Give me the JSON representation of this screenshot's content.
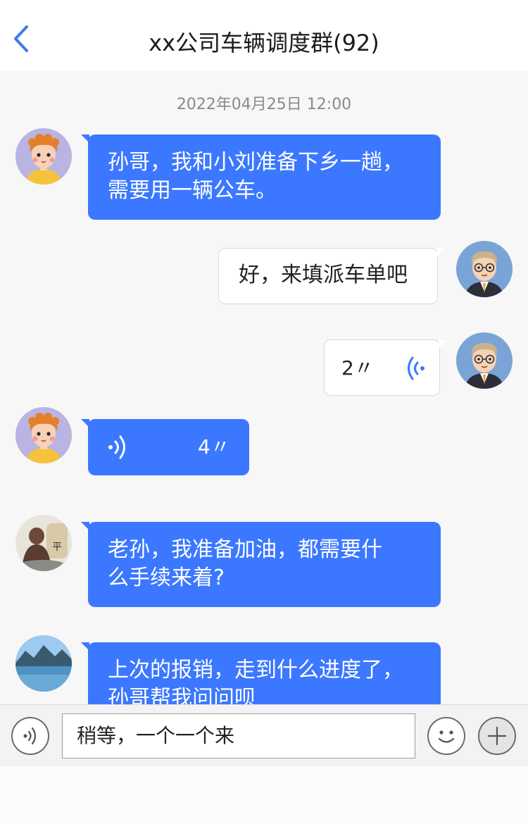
{
  "header": {
    "title": "xx公司车辆调度群(92)"
  },
  "chat": {
    "timestamp": "2022年04月25日 12:00",
    "messages": [
      {
        "side": "left",
        "type": "text",
        "text_line1": "孙哥，我和小刘准备下乡一趟，",
        "text_line2": "需要用一辆公车。"
      },
      {
        "side": "right",
        "type": "text",
        "text": "好，来填派车单吧"
      },
      {
        "side": "right",
        "type": "voice",
        "duration": "2〃"
      },
      {
        "side": "left",
        "type": "voice",
        "duration": "4〃"
      },
      {
        "side": "left",
        "type": "text",
        "text_line1": "老孙，我准备加油，都需要什",
        "text_line2": "么手续来着?"
      },
      {
        "side": "left",
        "type": "text",
        "text_line1": "上次的报销，走到什么进度了，",
        "text_line2": "孙哥帮我问问呗"
      }
    ]
  },
  "input": {
    "value": "稍等，一个一个来"
  },
  "colors": {
    "accent": "#3b78ff",
    "back": "#3a7bf0"
  },
  "icons": [
    "chevron-left-icon",
    "voice-icon",
    "emoji-icon",
    "plus-icon"
  ]
}
